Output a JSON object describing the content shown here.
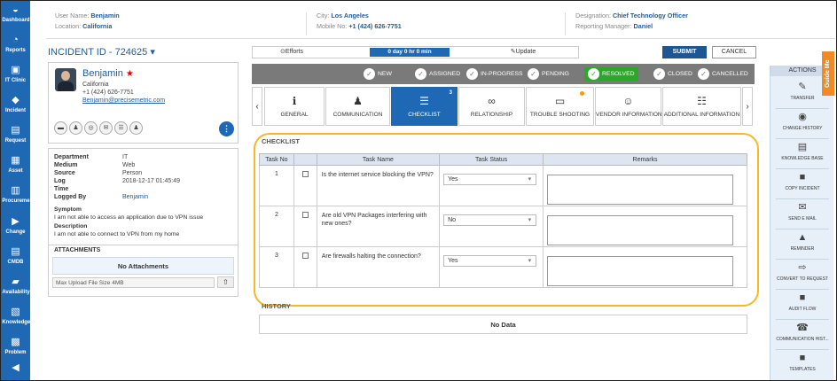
{
  "nav": [
    {
      "label": "Dashboard",
      "icon": "dashboard-icon",
      "g": "◒"
    },
    {
      "label": "Reports",
      "icon": "reports-icon",
      "g": "◔"
    },
    {
      "label": "IT Clinic",
      "icon": "it-clinic-icon",
      "g": "▣"
    },
    {
      "label": "Incident",
      "icon": "incident-icon",
      "g": "◆"
    },
    {
      "label": "Request",
      "icon": "request-icon",
      "g": "▤"
    },
    {
      "label": "Asset",
      "icon": "asset-icon",
      "g": "▦"
    },
    {
      "label": "Procurement",
      "icon": "procurement-icon",
      "g": "▥"
    },
    {
      "label": "Change",
      "icon": "change-icon",
      "g": "▶"
    },
    {
      "label": "CMDB",
      "icon": "cmdb-icon",
      "g": "▤"
    },
    {
      "label": "Availability",
      "icon": "availability-icon",
      "g": "▰"
    },
    {
      "label": "Knowledge",
      "icon": "knowledge-icon",
      "g": "▧"
    },
    {
      "label": "Problem",
      "icon": "problem-icon",
      "g": "▩"
    },
    {
      "label": "",
      "icon": "more-icon",
      "g": "◀"
    }
  ],
  "header": {
    "user_k": "User Name:",
    "user_v": "Benjamin",
    "loc_k": "Location:",
    "loc_v": "California",
    "city_k": "City:",
    "city_v": "Los Angeles",
    "mob_k": "Mobile No:",
    "mob_v": "+1 (424) 626-7751",
    "des_k": "Designation:",
    "des_v": "Chief Technology Officer",
    "mgr_k": "Reporting Manager:",
    "mgr_v": "Daniel"
  },
  "incident": {
    "id": "INCIDENT ID - 724625 ▾"
  },
  "person": {
    "name": "Benjamin",
    "star": "★",
    "state": "California",
    "phone": "+1 (424) 626-7751",
    "email": "Benjamin@precisemetric.com"
  },
  "details": {
    "rows": [
      [
        "Department",
        "IT"
      ],
      [
        "Medium",
        "Web"
      ],
      [
        "Source",
        "Person"
      ],
      [
        "Log",
        "2018-12-17 01:45:49"
      ],
      [
        "Time",
        ""
      ],
      [
        "Logged By",
        "Benjamin"
      ]
    ],
    "symptom_k": "Symptom",
    "symptom_v": "I am not able to access an application due to VPN issue",
    "desc_k": "Description",
    "desc_v": "I am not able to connect to VPN from my home",
    "attach_k": "ATTACHMENTS",
    "no_attach": "No Attachments",
    "upload": "Max Upload File Size 4MB"
  },
  "effort": {
    "efforts": "⊙Efforts",
    "time": "0 day 0 hr 0 min",
    "update": "✎Update"
  },
  "buttons": {
    "submit": "SUBMIT",
    "cancel": "CANCEL"
  },
  "statuses": [
    "NEW",
    "ASSIGNED",
    "IN-PROGRESS",
    "PENDING",
    "RESOLVED",
    "CLOSED",
    "CANCELLED"
  ],
  "tabs": [
    {
      "label": "GENERAL",
      "icon": "info-icon",
      "g": "ℹ"
    },
    {
      "label": "COMMUNICATION",
      "icon": "person-icon",
      "g": "♟"
    },
    {
      "label": "CHECKLIST",
      "icon": "checklist-icon",
      "g": "☰",
      "count": "3"
    },
    {
      "label": "RELATIONSHIP",
      "icon": "relationship-icon",
      "g": "∞"
    },
    {
      "label": "TROUBLE SHOOTING",
      "icon": "monitor-icon",
      "g": "▭"
    },
    {
      "label": "VENDOR INFORMATION",
      "icon": "vendor-icon",
      "g": "☺"
    },
    {
      "label": "ADDITIONAL INFORMATION",
      "icon": "document-icon",
      "g": "☷"
    }
  ],
  "checklist": {
    "title": "CHECKLIST",
    "cols": [
      "Task No",
      "",
      "Task Name",
      "Task Status",
      "Remarks"
    ],
    "rows": [
      {
        "no": "1",
        "name": "Is the internet service blocking the VPN?",
        "status": "Yes"
      },
      {
        "no": "2",
        "name": "Are old VPN Packages interfering with new ones?",
        "status": "No"
      },
      {
        "no": "3",
        "name": "Are firewalls halting the connection?",
        "status": "Yes"
      }
    ]
  },
  "history": {
    "title": "HISTORY",
    "empty": "No Data"
  },
  "actions": {
    "title": "ACTIONS",
    "items": [
      {
        "label": "TRANSFER",
        "icon": "transfer-icon",
        "g": "✎"
      },
      {
        "label": "CHANGE HISTORY",
        "icon": "history-icon",
        "g": "◉"
      },
      {
        "label": "KNOWLEDGE BASE",
        "icon": "knowledge-base-icon",
        "g": "▤"
      },
      {
        "label": "COPY INCIDENT",
        "icon": "copy-icon",
        "g": "■"
      },
      {
        "label": "SEND E MAIL",
        "icon": "email-icon",
        "g": "✉"
      },
      {
        "label": "REMINDER",
        "icon": "reminder-icon",
        "g": "▲"
      },
      {
        "label": "CONVERT TO REQUEST",
        "icon": "convert-icon",
        "g": "⇨"
      },
      {
        "label": "AUDIT FLOW",
        "icon": "audit-icon",
        "g": "■"
      },
      {
        "label": "COMMUNICATION HIST...",
        "icon": "communication-history-icon",
        "g": "☎"
      },
      {
        "label": "TEMPLATES",
        "icon": "templates-icon",
        "g": "■"
      }
    ]
  },
  "guide": "Guide Me"
}
